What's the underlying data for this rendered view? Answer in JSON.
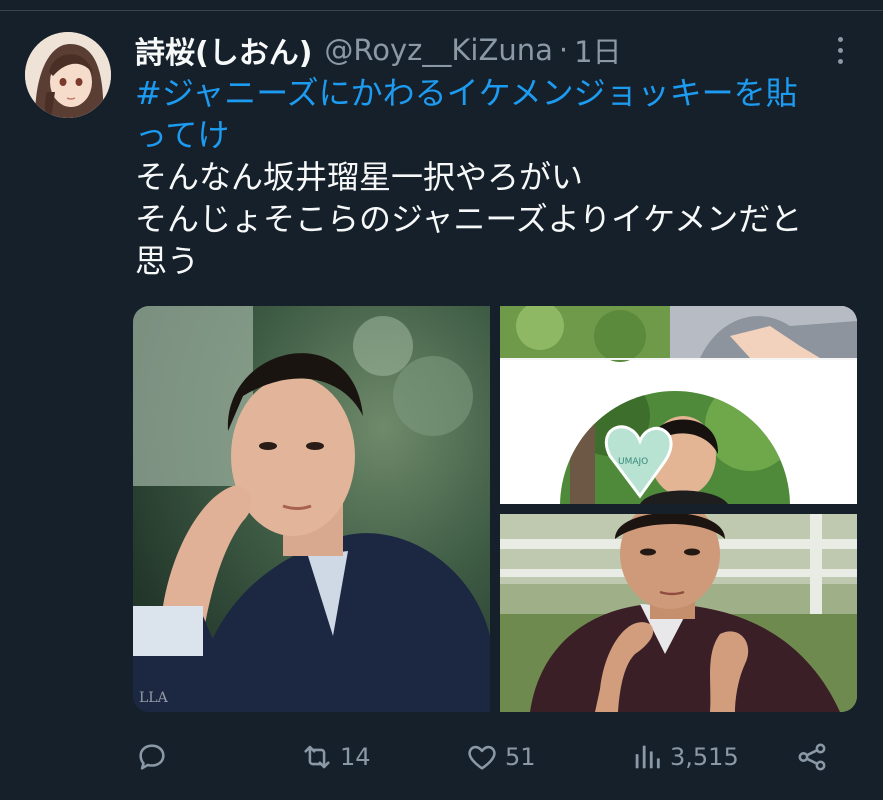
{
  "tweet": {
    "display_name": "詩桜(しおん)",
    "handle": "@Royz__KiZuna",
    "separator": "·",
    "time": "1日",
    "hashtag_line1": "#ジャニーズにかわるイケメンジョッキーを貼",
    "hashtag_line2": "ってけ",
    "body_line1": "そんなん坂井瑠星一択やろがい",
    "body_line2": "そんじょそこらのジャニーズよりイケメンだと",
    "body_line3": "思う",
    "photo_badge_text": "UMAJO",
    "photo_watermark": "LLA"
  },
  "actions": {
    "reply_icon": "reply-icon",
    "retweet_count": "14",
    "like_count": "51",
    "views_count": "3,515",
    "share_icon": "share-icon"
  },
  "colors": {
    "background": "#15202b",
    "text": "#f7f9f9",
    "muted": "#8b98a5",
    "link": "#1d9bf0"
  }
}
